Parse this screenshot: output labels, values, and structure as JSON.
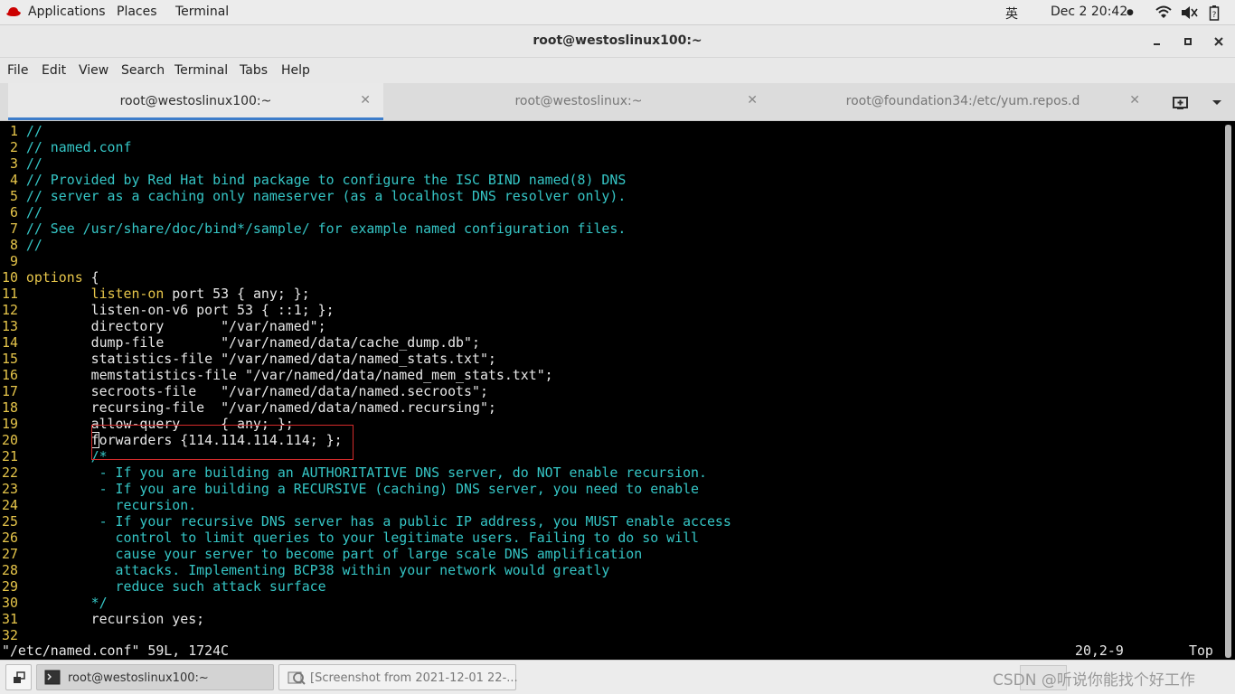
{
  "topbar": {
    "applications": "Applications",
    "places": "Places",
    "terminal": "Terminal",
    "ime": "英",
    "clock": "Dec 2  20:42",
    "clock_dot": "●",
    "icons": [
      "wifi-icon",
      "volume-icon",
      "battery-icon"
    ]
  },
  "window": {
    "title": "root@westoslinux100:~"
  },
  "menubar": [
    "File",
    "Edit",
    "View",
    "Search",
    "Terminal",
    "Tabs",
    "Help"
  ],
  "tabs": [
    {
      "label": "root@westoslinux100:~",
      "active": true
    },
    {
      "label": "root@westoslinux:~",
      "active": false
    },
    {
      "label": "root@foundation34:/etc/yum.repos.d",
      "active": false
    }
  ],
  "editor": {
    "lines": [
      {
        "n": "1",
        "t": "//"
      },
      {
        "n": "2",
        "t": "// named.conf"
      },
      {
        "n": "3",
        "t": "//"
      },
      {
        "n": "4",
        "t": "// Provided by Red Hat bind package to configure the ISC BIND named(8) DNS"
      },
      {
        "n": "5",
        "t": "// server as a caching only nameserver (as a localhost DNS resolver only)."
      },
      {
        "n": "6",
        "t": "//"
      },
      {
        "n": "7",
        "t": "// See /usr/share/doc/bind*/sample/ for example named configuration files."
      },
      {
        "n": "8",
        "t": "//"
      },
      {
        "n": "9",
        "t": ""
      },
      {
        "n": "10",
        "t": "options {"
      },
      {
        "n": "11",
        "t": "        listen-on port 53 { any; };"
      },
      {
        "n": "12",
        "t": "        listen-on-v6 port 53 { ::1; };"
      },
      {
        "n": "13",
        "t": "        directory       \"/var/named\";"
      },
      {
        "n": "14",
        "t": "        dump-file       \"/var/named/data/cache_dump.db\";"
      },
      {
        "n": "15",
        "t": "        statistics-file \"/var/named/data/named_stats.txt\";"
      },
      {
        "n": "16",
        "t": "        memstatistics-file \"/var/named/data/named_mem_stats.txt\";"
      },
      {
        "n": "17",
        "t": "        secroots-file   \"/var/named/data/named.secroots\";"
      },
      {
        "n": "18",
        "t": "        recursing-file  \"/var/named/data/named.recursing\";"
      },
      {
        "n": "19",
        "t": "        allow-query     { any; };"
      },
      {
        "n": "20",
        "t": "        forwarders {114.114.114.114; };"
      },
      {
        "n": "21",
        "t": "        /*"
      },
      {
        "n": "22",
        "t": "         - If you are building an AUTHORITATIVE DNS server, do NOT enable recursion."
      },
      {
        "n": "23",
        "t": "         - If you are building a RECURSIVE (caching) DNS server, you need to enable"
      },
      {
        "n": "24",
        "t": "           recursion."
      },
      {
        "n": "25",
        "t": "         - If your recursive DNS server has a public IP address, you MUST enable access"
      },
      {
        "n": "26",
        "t": "           control to limit queries to your legitimate users. Failing to do so will"
      },
      {
        "n": "27",
        "t": "           cause your server to become part of large scale DNS amplification"
      },
      {
        "n": "28",
        "t": "           attacks. Implementing BCP38 within your network would greatly"
      },
      {
        "n": "29",
        "t": "           reduce such attack surface"
      },
      {
        "n": "30",
        "t": "        */"
      },
      {
        "n": "31",
        "t": "        recursion yes;"
      },
      {
        "n": "32",
        "t": ""
      }
    ],
    "status_file": "\"/etc/named.conf\" 59L, 1724C",
    "status_pos": "20,2-9",
    "status_scroll": "Top"
  },
  "taskbar": {
    "items": [
      {
        "label": "root@westoslinux100:~"
      },
      {
        "label": "[Screenshot from 2021-12-01 22-..."
      }
    ],
    "watermark": "CSDN @听说你能找个好工作"
  }
}
